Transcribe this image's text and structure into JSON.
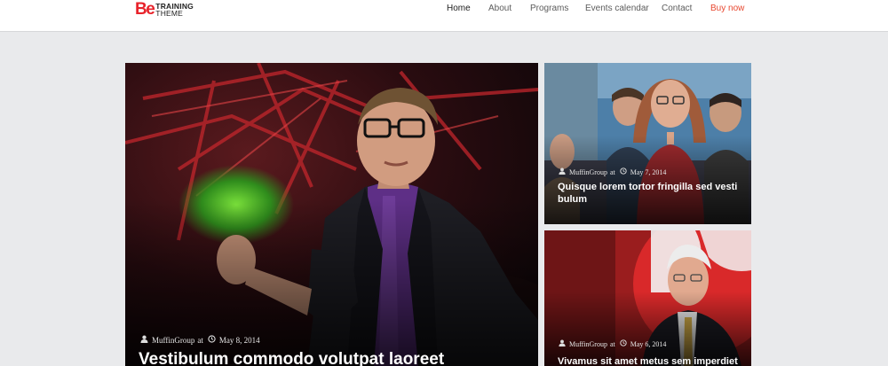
{
  "brand": {
    "mark": "Be",
    "line1": "TRAINING",
    "line2": "THEME"
  },
  "nav": {
    "items": [
      {
        "label": "Home"
      },
      {
        "label": "About"
      },
      {
        "label": "Programs"
      },
      {
        "label": "Events calendar"
      },
      {
        "label": "Contact"
      },
      {
        "label": "Buy now"
      }
    ],
    "active": "Home"
  },
  "posts": [
    {
      "author": "MuffinGroup",
      "at": "at",
      "date": "May 8, 2014",
      "title": "Vestibulum commodo volutpat laoreet"
    },
    {
      "author": "MuffinGroup",
      "at": "at",
      "date": "May 7, 2014",
      "title": "Quisque lorem tortor fringilla sed vesti bulum"
    },
    {
      "author": "MuffinGroup",
      "at": "at",
      "date": "May 6, 2014",
      "title": "Vivamus sit amet metus sem imperdiet"
    }
  ],
  "colors": {
    "accent": "#e8232b",
    "buy_now": "#e8472f",
    "page_bg": "#e9eaec"
  }
}
